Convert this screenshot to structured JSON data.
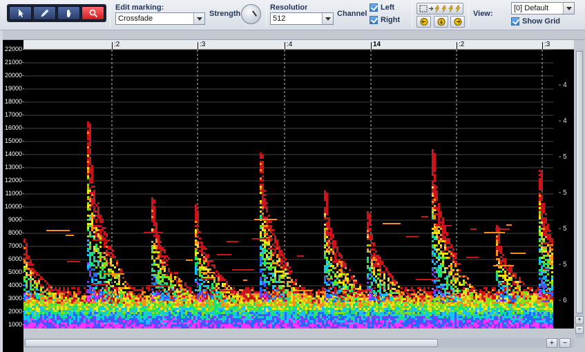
{
  "toolbar": {
    "tools": [
      {
        "name": "select",
        "icon": "arrow-pointer-icon",
        "active": false
      },
      {
        "name": "pencil",
        "icon": "pencil-icon",
        "active": false
      },
      {
        "name": "hand",
        "icon": "hand-icon",
        "active": false
      },
      {
        "name": "zoom",
        "icon": "magnifier-icon",
        "active": true
      }
    ],
    "edit_marking_label": "Edit marking:",
    "edit_marking_value": "Crossfade",
    "strength_label": "Strength",
    "resolution_label": "Resolution",
    "resolution_value": "512",
    "channel_label": "Channel",
    "left_label": "Left",
    "right_label": "Right",
    "view_label": "View:",
    "view_value": "[0] Default",
    "show_grid_label": "Show Grid"
  },
  "spectrogram": {
    "y_ticks": [
      "22000",
      "21000",
      "20000",
      "19000",
      "18000",
      "17000",
      "16000",
      "15000",
      "14000",
      "13000",
      "12000",
      "11000",
      "10000",
      "9000",
      "8000",
      "7000",
      "6000",
      "5000",
      "4000",
      "3000",
      "2000",
      "1000"
    ],
    "time_labels": [
      ":2",
      ":3",
      ":4",
      "14",
      ":2",
      ":3"
    ],
    "right_scale": [
      "- 4",
      "- 4",
      "- 5",
      "- 5",
      "- 5",
      "- 5",
      "- 6"
    ],
    "colors": {
      "background": "#000000",
      "grid": "#ffffff"
    }
  },
  "scroll": {
    "plus": "+",
    "minus": "−"
  }
}
